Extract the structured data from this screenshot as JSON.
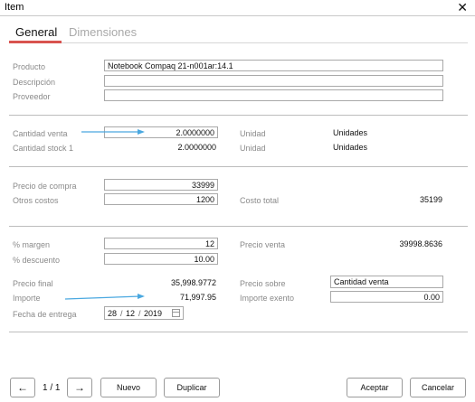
{
  "window": {
    "title": "Item",
    "close_glyph": "✕"
  },
  "tabs": [
    {
      "label": "General",
      "active": true
    },
    {
      "label": "Dimensiones",
      "active": false
    }
  ],
  "product_section": {
    "producto_label": "Producto",
    "producto_value": "Notebook Compaq 21-n001ar:14.1",
    "descripcion_label": "Descripción",
    "descripcion_value": "",
    "proveedor_label": "Proveedor",
    "proveedor_value": ""
  },
  "qty_section": {
    "cantidad_venta_label": "Cantidad venta",
    "cantidad_venta_value": "2.0000000",
    "cantidad_stock_label": "Cantidad stock 1",
    "cantidad_stock_value": "2.0000000",
    "unidad1_label": "Unidad",
    "unidad1_value": "Unidades",
    "unidad2_label": "Unidad",
    "unidad2_value": "Unidades"
  },
  "cost_section": {
    "precio_compra_label": "Precio de compra",
    "precio_compra_value": "33999",
    "otros_costos_label": "Otros costos",
    "otros_costos_value": "1200",
    "costo_total_label": "Costo total",
    "costo_total_value": "35199"
  },
  "price_section": {
    "margen_label": "% margen",
    "margen_value": "12",
    "descuento_label": "% descuento",
    "descuento_value": "10.00",
    "precio_venta_label": "Precio venta",
    "precio_venta_value": "39998.8636",
    "precio_final_label": "Precio final",
    "precio_final_value": "35,998.9772",
    "importe_label": "Importe",
    "importe_value": "71,997.95",
    "precio_sobre_label": "Precio sobre",
    "precio_sobre_value": "Cantidad venta",
    "importe_exento_label": "Importe exento",
    "importe_exento_value": "0.00",
    "fecha_entrega_label": "Fecha de entrega",
    "fecha_day": "28",
    "fecha_month": "12",
    "fecha_year": "2019",
    "fecha_sep": "/"
  },
  "annotations": {
    "arrow_color": "#4aa8e0"
  },
  "footer": {
    "prev_glyph": "←",
    "page_indicator": "1 / 1",
    "next_glyph": "→",
    "nuevo": "Nuevo",
    "duplicar": "Duplicar",
    "aceptar": "Aceptar",
    "cancelar": "Cancelar"
  },
  "colors": {
    "accent": "#d9534f",
    "label": "#8a8a8a",
    "border": "#a9a9a9"
  }
}
